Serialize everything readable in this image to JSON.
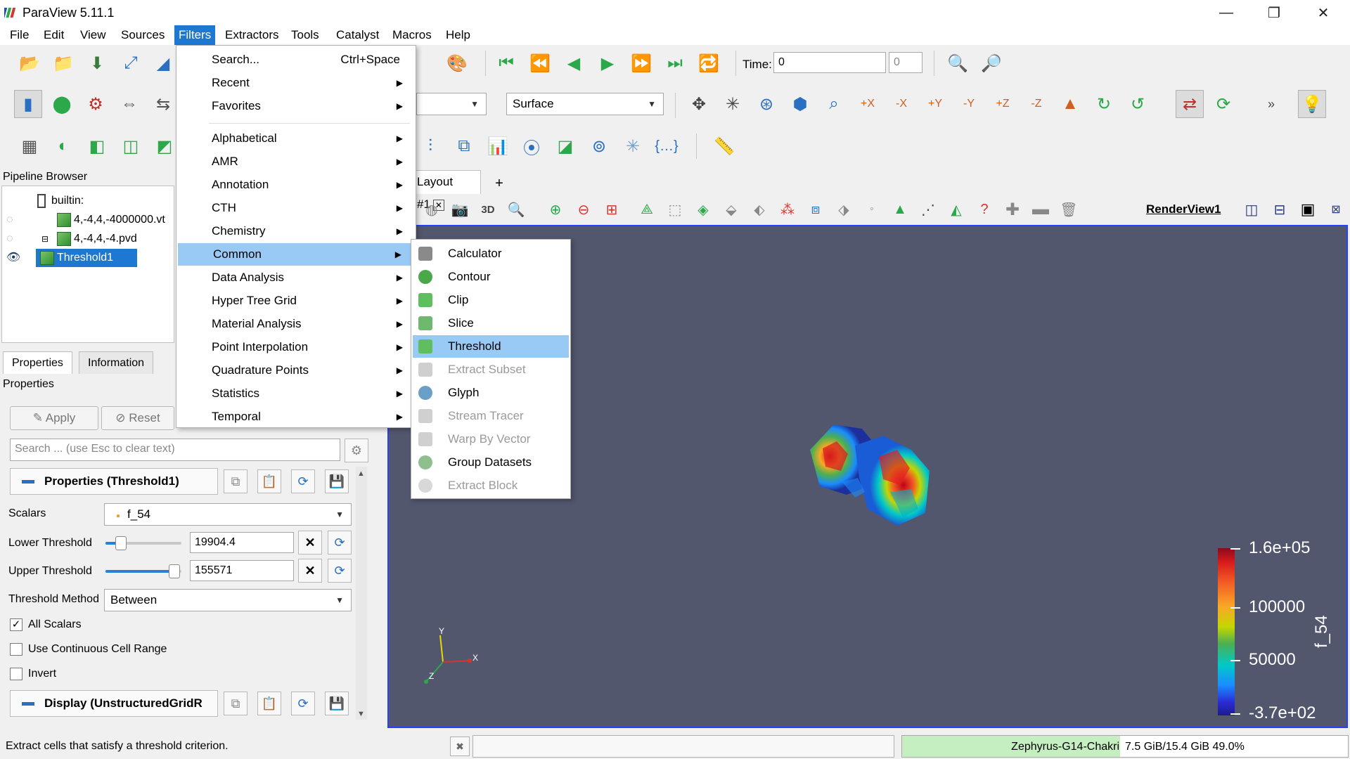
{
  "window": {
    "title": "ParaView 5.11.1",
    "minimize": "—",
    "maximize": "❐",
    "close": "✕"
  },
  "menubar": [
    "File",
    "Edit",
    "View",
    "Sources",
    "Filters",
    "Extractors",
    "Tools",
    "Catalyst",
    "Macros",
    "Help"
  ],
  "toolbar": {
    "time_label": "Time:",
    "time_value": "0",
    "time_index": "0",
    "representation": "Surface"
  },
  "pipeline": {
    "header": "Pipeline Browser",
    "items": [
      "builtin:",
      "4,-4,4,-4000000.vt",
      "4,-4,4,-4.pvd",
      "Threshold1"
    ]
  },
  "properties": {
    "tabs": [
      "Properties",
      "Information"
    ],
    "label": "Properties",
    "apply": "Apply",
    "reset": "Reset",
    "search_placeholder": "Search ... (use Esc to clear text)",
    "section_props": "Properties (Threshold1)",
    "scalars_label": "Scalars",
    "scalars_value": "f_54",
    "lower_label": "Lower Threshold",
    "lower_value": "19904.4",
    "upper_label": "Upper Threshold",
    "upper_value": "155571",
    "method_label": "Threshold Method",
    "method_value": "Between",
    "all_scalars": "All Scalars",
    "continuous": "Use Continuous Cell Range",
    "invert": "Invert",
    "section_display": "Display (UnstructuredGridR"
  },
  "layout": {
    "tab": "Layout #1",
    "add": "+",
    "mode_3d": "3D",
    "render_view": "RenderView1"
  },
  "legend": {
    "title": "f_54",
    "labels": [
      "1.6e+05",
      "100000",
      "50000",
      "-3.7e+02"
    ]
  },
  "axes": {
    "y": "Y",
    "x": "X",
    "z": "Z"
  },
  "filters_menu": {
    "search": "Search...",
    "search_shortcut": "Ctrl+Space",
    "items_top": [
      "Recent",
      "Favorites"
    ],
    "items": [
      "Alphabetical",
      "AMR",
      "Annotation",
      "CTH",
      "Chemistry",
      "Common",
      "Data Analysis",
      "Hyper Tree Grid",
      "Material Analysis",
      "Point Interpolation",
      "Quadrature Points",
      "Statistics",
      "Temporal"
    ]
  },
  "common_menu": {
    "items": [
      "Calculator",
      "Contour",
      "Clip",
      "Slice",
      "Threshold",
      "Extract Subset",
      "Glyph",
      "Stream Tracer",
      "Warp By Vector",
      "Group Datasets",
      "Extract Block"
    ]
  },
  "status": {
    "text": "Extract cells that satisfy a threshold criterion.",
    "host": "Zephyrus-G14-Chakri",
    "memory": "7.5 GiB/15.4 GiB 49.0%"
  }
}
